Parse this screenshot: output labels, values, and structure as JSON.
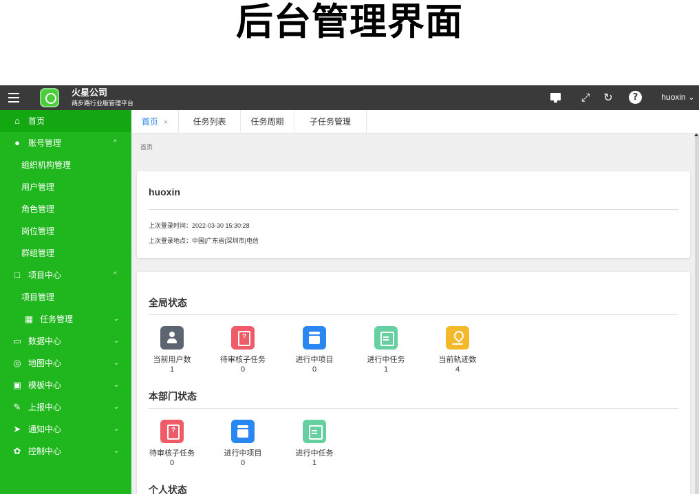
{
  "poster": {
    "title": "后台管理界面"
  },
  "header": {
    "company": "火星公司",
    "tagline": "两步路行业版管理平台",
    "username": "huoxin",
    "icons": [
      "menu-icon",
      "app-logo-icon",
      "monitor-icon",
      "fullscreen-icon",
      "refresh-icon",
      "help-icon"
    ]
  },
  "sidebar": {
    "items": [
      {
        "label": "首页",
        "icon": "home-icon",
        "chevron": ""
      },
      {
        "label": "账号管理",
        "icon": "user-icon",
        "chevron": "^"
      },
      {
        "label": "组织机构管理"
      },
      {
        "label": "用户管理"
      },
      {
        "label": "角色管理"
      },
      {
        "label": "岗位管理"
      },
      {
        "label": "群组管理"
      },
      {
        "label": "项目中心",
        "icon": "folder-icon",
        "chevron": "^"
      },
      {
        "label": "项目管理"
      },
      {
        "label": "任务管理",
        "icon": "grid-icon",
        "chevron": "⌄"
      },
      {
        "label": "数据中心",
        "icon": "database-icon",
        "chevron": "⌄"
      },
      {
        "label": "地图中心",
        "icon": "map-icon",
        "chevron": "⌄"
      },
      {
        "label": "模板中心",
        "icon": "template-icon",
        "chevron": "⌄"
      },
      {
        "label": "上报中心",
        "icon": "pen-icon",
        "chevron": "⌄"
      },
      {
        "label": "通知中心",
        "icon": "send-icon",
        "chevron": "⌄"
      },
      {
        "label": "控制中心",
        "icon": "gear-icon",
        "chevron": "⌄"
      }
    ]
  },
  "tabs": [
    {
      "label": "首页",
      "close": "×"
    },
    {
      "label": "任务列表"
    },
    {
      "label": "任务周期"
    },
    {
      "label": "子任务管理"
    }
  ],
  "breadcrumb": "首页",
  "profile": {
    "name": "huoxin",
    "last_login_time": "上次登录时间：2022-03-30 15:30:28",
    "last_login_place": "上次登录地点：中国|广东省|深圳市|电信"
  },
  "global_status": {
    "title": "全局状态",
    "stats": [
      {
        "label": "当前用户数",
        "value": "1",
        "icon": "user-icon"
      },
      {
        "label": "待审核子任务",
        "value": "0",
        "icon": "audit-icon"
      },
      {
        "label": "进行中项目",
        "value": "0",
        "icon": "project-icon"
      },
      {
        "label": "进行中任务",
        "value": "1",
        "icon": "task-icon"
      },
      {
        "label": "当前轨迹数",
        "value": "4",
        "icon": "track-icon"
      }
    ]
  },
  "department_status": {
    "title": "本部门状态",
    "stats": [
      {
        "label": "待审核子任务",
        "value": "0",
        "icon": "audit-icon"
      },
      {
        "label": "进行中项目",
        "value": "0",
        "icon": "project-icon"
      },
      {
        "label": "进行中任务",
        "value": "1",
        "icon": "task-icon"
      }
    ]
  },
  "personal_status": {
    "title": "个人状态"
  }
}
